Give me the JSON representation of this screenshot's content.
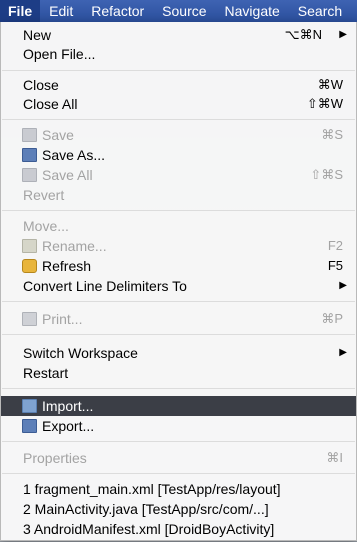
{
  "menubar": {
    "items": [
      "File",
      "Edit",
      "Refactor",
      "Source",
      "Navigate",
      "Search"
    ]
  },
  "menu": {
    "new": {
      "label": "New",
      "shortcut": "⌥⌘N"
    },
    "open_file": {
      "label": "Open File..."
    },
    "close": {
      "label": "Close",
      "shortcut": "⌘W"
    },
    "close_all": {
      "label": "Close All",
      "shortcut": "⇧⌘W"
    },
    "save": {
      "label": "Save",
      "shortcut": "⌘S"
    },
    "save_as": {
      "label": "Save As..."
    },
    "save_all": {
      "label": "Save All",
      "shortcut": "⇧⌘S"
    },
    "revert": {
      "label": "Revert"
    },
    "move": {
      "label": "Move..."
    },
    "rename": {
      "label": "Rename...",
      "shortcut": "F2"
    },
    "refresh": {
      "label": "Refresh",
      "shortcut": "F5"
    },
    "convert": {
      "label": "Convert Line Delimiters To"
    },
    "print": {
      "label": "Print...",
      "shortcut": "⌘P"
    },
    "switch_workspace": {
      "label": "Switch Workspace"
    },
    "restart": {
      "label": "Restart"
    },
    "import": {
      "label": "Import..."
    },
    "export": {
      "label": "Export..."
    },
    "properties": {
      "label": "Properties",
      "shortcut": "⌘I"
    },
    "recent": [
      "1 fragment_main.xml  [TestApp/res/layout]",
      "2 MainActivity.java  [TestApp/src/com/...]",
      "3 AndroidManifest.xml  [DroidBoyActivity]"
    ]
  },
  "colors": {
    "menubar": "#2b4f9d",
    "highlight": "#3b3e46",
    "disabled_text": "#a3a3a3"
  }
}
